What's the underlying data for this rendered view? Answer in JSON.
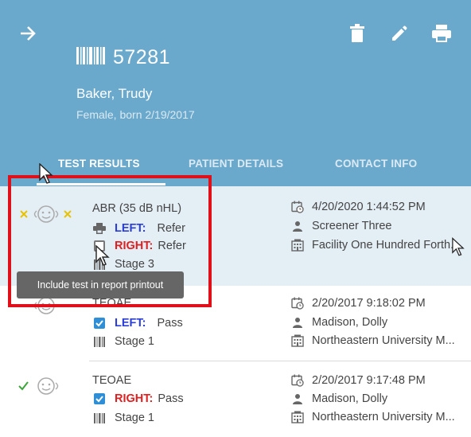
{
  "header": {
    "patient_id": "57281",
    "patient_name": "Baker, Trudy",
    "patient_info": "Female, born 2/19/2017",
    "icons": [
      "arrow-right-icon",
      "barcode-icon",
      "trash-icon",
      "pencil-icon",
      "printer-icon"
    ]
  },
  "tabs": [
    {
      "label": "TEST RESULTS",
      "active": true
    },
    {
      "label": "PATIENT DETAILS",
      "active": false
    },
    {
      "label": "CONTACT INFO",
      "active": false
    }
  ],
  "tests": [
    {
      "title": "ABR (35 dB nHL)",
      "status": "refer-both",
      "left_label": "LEFT:",
      "left_result": "Refer",
      "right_label": "RIGHT:",
      "right_result": "Refer",
      "stage": "Stage 3",
      "datetime": "4/20/2020 1:44:52 PM",
      "screener": "Screener Three",
      "facility": "Facility One Hundred Forth..."
    },
    {
      "title": "TEOAE",
      "status": "pass",
      "left_label": "LEFT:",
      "left_result": "Pass",
      "stage": "Stage 1",
      "datetime": "2/20/2017 9:18:02 PM",
      "screener": "Madison, Dolly",
      "facility": "Northeastern University M..."
    },
    {
      "title": "TEOAE",
      "status": "pass",
      "right_label": "RIGHT:",
      "right_result": "Pass",
      "stage": "Stage 1",
      "datetime": "2/20/2017 9:17:48 PM",
      "screener": "Madison, Dolly",
      "facility": "Northeastern University M..."
    }
  ],
  "tooltip": "Include test in report printout",
  "colors": {
    "header_bg": "#6aa9cc",
    "selected_row_bg": "#e4eef5",
    "left_label": "#2b3fd6",
    "right_label": "#e02020",
    "refer_icon": "#e8c200",
    "pass_icon": "#3aa53a",
    "highlight": "#e0101a",
    "checkbox_checked": "#2f8fd6"
  }
}
